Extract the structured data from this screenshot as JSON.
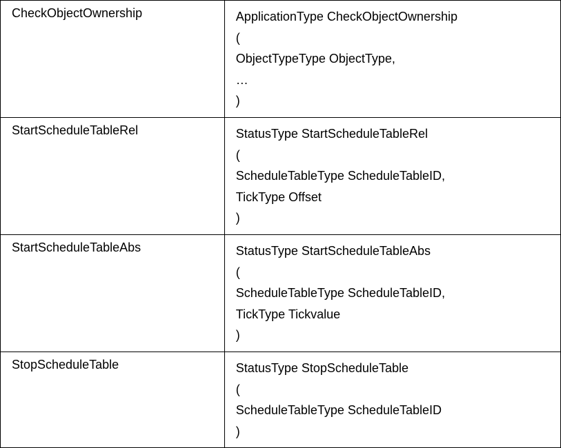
{
  "rows": [
    {
      "name": "CheckObjectOwnership",
      "sig": [
        "ApplicationType CheckObjectOwnership",
        "(",
        "ObjectTypeType ObjectType,",
        "…",
        ")"
      ]
    },
    {
      "name": "StartScheduleTableRel",
      "sig": [
        "StatusType StartScheduleTableRel",
        "(",
        "ScheduleTableType ScheduleTableID,",
        "TickType Offset",
        ")"
      ]
    },
    {
      "name": "StartScheduleTableAbs",
      "sig": [
        "StatusType StartScheduleTableAbs",
        "(",
        "ScheduleTableType ScheduleTableID,",
        "TickType Tickvalue",
        ")"
      ]
    },
    {
      "name": "StopScheduleTable",
      "sig": [
        "StatusType StopScheduleTable",
        "(",
        "ScheduleTableType ScheduleTableID",
        ")"
      ]
    }
  ]
}
